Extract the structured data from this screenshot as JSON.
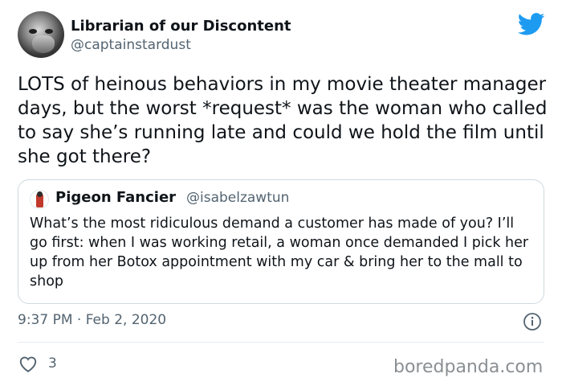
{
  "author": {
    "display_name": "Librarian of our Discontent",
    "handle": "@captainstardust",
    "avatar_icon": "user-avatar-photo"
  },
  "platform_icon": "twitter-bird-icon",
  "tweet": {
    "text": "LOTS of heinous behaviors in my movie theater manager days, but the worst *request* was the woman who called to say she’s running late and could we hold the film until she got there?",
    "timestamp": "9:37 PM · Feb 2, 2020",
    "like_count": "3"
  },
  "quoted_tweet": {
    "display_name": "Pigeon Fancier",
    "handle": "@isabelzawtun",
    "text": "What’s the most ridiculous demand a customer has made of you? I’ll go first: when I was working retail, a woman once demanded I pick her up from her Botox appointment with my car & bring her to the mall to shop"
  },
  "watermark": "boredpanda.com",
  "colors": {
    "twitter_blue": "#1d9bf0",
    "text_primary": "#0f1419",
    "text_secondary": "#536471",
    "border": "#cfd9de"
  }
}
